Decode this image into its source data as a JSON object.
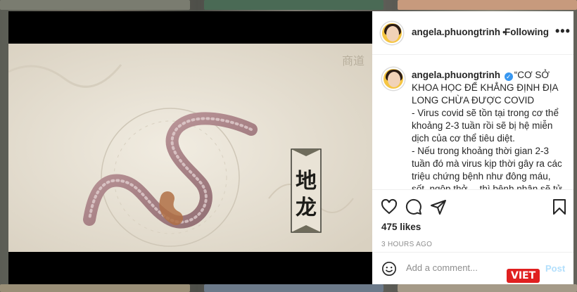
{
  "post": {
    "username": "angela.phuongtrinh",
    "follow_label": "Following",
    "caption": "“CƠ SỞ KHOA HỌC ĐỂ KHẲNG ĐỊNH ĐỊA LONG CHỪA ĐƯỢC COVID\n- Virus covid sẽ tồn tại trong cơ thể khoảng 2-3 tuần rồi sẽ bị hệ miễn dịch của cơ thể tiêu diệt.\n- Nếu trong khoảng thời gian 2-3 tuần đó mà virus kịp thời gây ra các triệu chứng bệnh như đông máu, sốt, ngộp thở… thì bệnh nhân sẽ tử vong trước khi virus biến mất.",
    "likes": "475 likes",
    "time": "3 HOURS AGO"
  },
  "comment": {
    "placeholder": "Add a comment...",
    "post_label": "Post"
  },
  "media": {
    "calligraphy": "地龙",
    "watermark": "商道"
  },
  "watermark_logo": "VIET",
  "colors": {
    "verified": "#3897f0",
    "post_disabled": "#b2dffc",
    "logo_red": "#e02020"
  },
  "icons": [
    "heart-icon",
    "comment-icon",
    "share-icon",
    "bookmark-icon",
    "emoji-icon",
    "more-icon",
    "verified-icon"
  ]
}
